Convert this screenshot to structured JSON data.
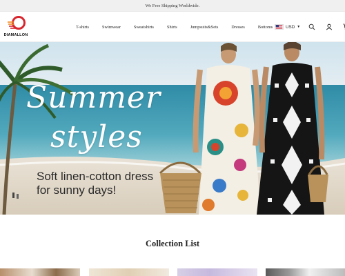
{
  "announcement": {
    "text": "We Free Shipping Worldwide."
  },
  "brand": {
    "name": "DIAMALLON"
  },
  "nav": {
    "items": [
      {
        "label": "T-shirts"
      },
      {
        "label": "Swimwear"
      },
      {
        "label": "Sweatshirts"
      },
      {
        "label": "Shirts"
      },
      {
        "label": "Jumpsuits&Sets"
      },
      {
        "label": "Dresses"
      },
      {
        "label": "Bottoms"
      }
    ]
  },
  "currency": {
    "code": "USD",
    "flag_icon": "us-flag-icon"
  },
  "header_icons": [
    "search-icon",
    "account-icon",
    "cart-icon"
  ],
  "hero": {
    "title_line1": "Summer",
    "title_line2": "styles",
    "subtitle_line1": "Soft linen-cotton dress",
    "subtitle_line2": "for sunny days!"
  },
  "collection": {
    "title": "Collection List"
  },
  "colors": {
    "logo_red": "#d7262e",
    "logo_orange": "#f08a24",
    "announce_bg": "#f0f0f0"
  }
}
